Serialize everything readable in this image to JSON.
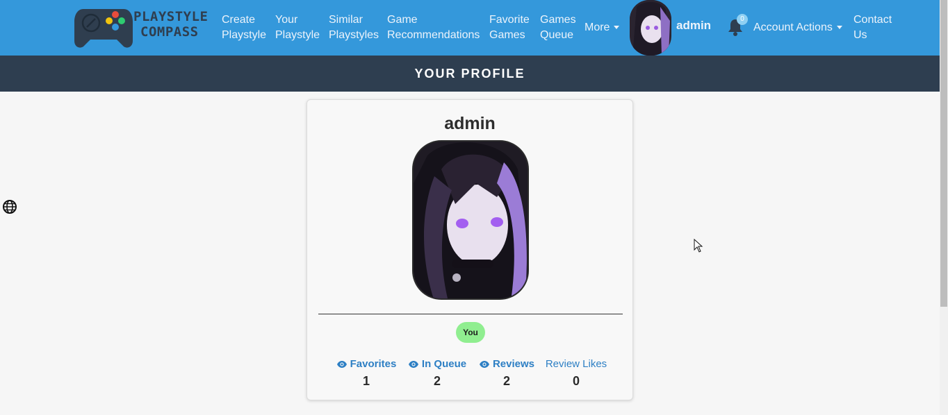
{
  "app": {
    "logo_line1": "PLAYSTYLE",
    "logo_line2": "COMPASS"
  },
  "nav": {
    "items": [
      {
        "line1": "Create",
        "line2": "Playstyle"
      },
      {
        "line1": "Your",
        "line2": "Playstyle"
      },
      {
        "line1": "Similar",
        "line2": "Playstyles"
      },
      {
        "line1": "Game",
        "line2": "Recommendations"
      },
      {
        "line1": "Favorite",
        "line2": "Games"
      },
      {
        "line1": "Games",
        "line2": "Queue"
      }
    ],
    "more_label": "More",
    "username": "admin",
    "notification_count": "0",
    "account_actions_label": "Account Actions",
    "contact_line1": "Contact",
    "contact_line2": "Us"
  },
  "header": {
    "title": "YOUR PROFILE"
  },
  "profile": {
    "username": "admin",
    "badge": "You",
    "stats": [
      {
        "label": "Favorites",
        "value": "1",
        "icon": "eye-icon"
      },
      {
        "label": "In Queue",
        "value": "2",
        "icon": "eye-icon"
      },
      {
        "label": "Reviews",
        "value": "2",
        "icon": "eye-icon"
      },
      {
        "label": "Review Likes",
        "value": "0",
        "icon": ""
      }
    ]
  },
  "colors": {
    "navbar": "#3498db",
    "header": "#2e3e50",
    "link": "#2d7fc4",
    "badge": "#90ee90"
  }
}
